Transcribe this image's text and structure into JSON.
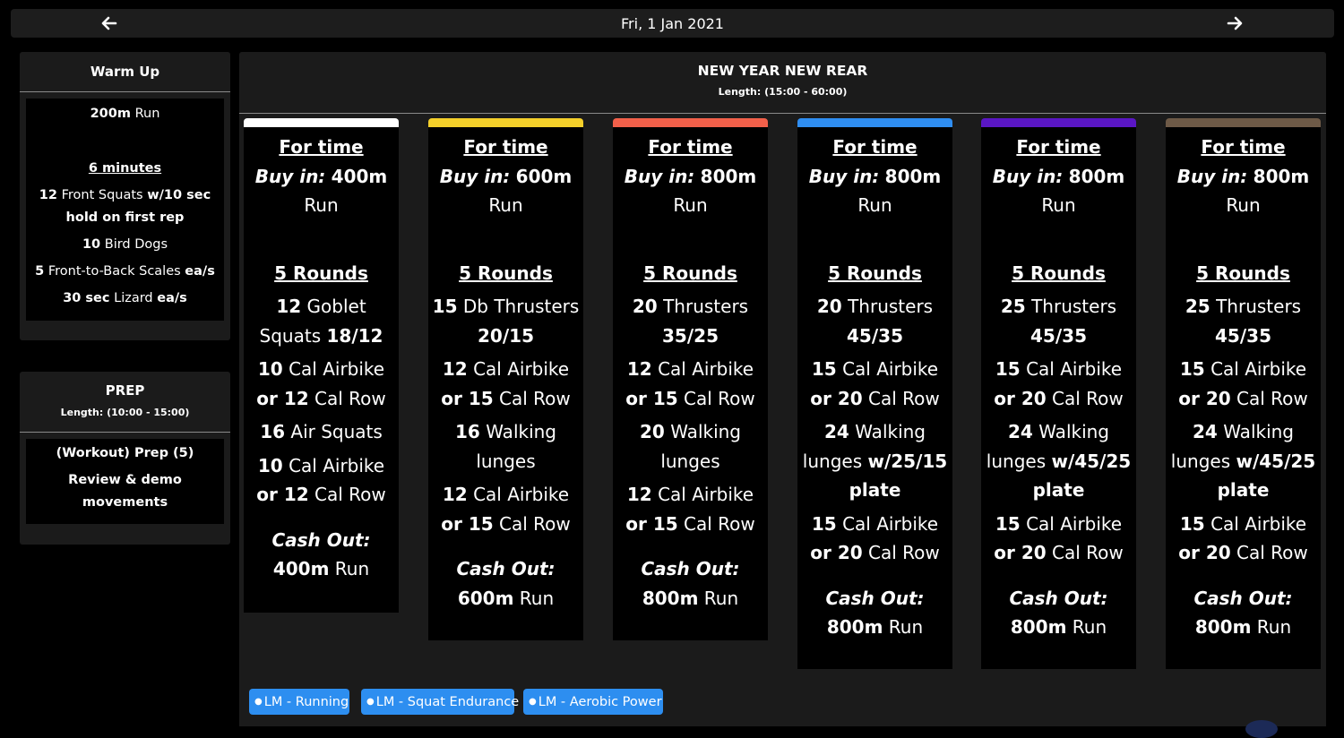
{
  "header": {
    "date": "Fri, 1 Jan 2021",
    "prev_icon": "arrow-left-icon",
    "next_icon": "arrow-right-icon"
  },
  "warmup": {
    "title": "Warm Up",
    "lines": [
      {
        "bold": "200m",
        "text": " Run"
      },
      {
        "underline": "6 minutes"
      },
      {
        "bold": "12",
        "text": " Front Squats ",
        "bold2": "w/10 sec hold on first rep"
      },
      {
        "bold": "10",
        "text": " Bird Dogs"
      },
      {
        "bold": "5",
        "text": " Front-to-Back Scales ",
        "bold2": "ea/s"
      },
      {
        "bold": "30 sec",
        "text": " Lizard ",
        "bold2": "ea/s"
      }
    ]
  },
  "prep": {
    "title": "PREP",
    "length": "Length: (10:00 - 15:00)",
    "line1": "(Workout) Prep (5)",
    "line2": "Review & demo movements"
  },
  "workout": {
    "title": "NEW YEAR NEW REAR",
    "length": "Length: (15:00 - 60:00)",
    "columns": [
      {
        "color": "#ffffff",
        "heading": "For time",
        "buyin_label": "Buy in:",
        "buyin_value": "400m",
        "buyin_text": "Run",
        "rounds": "5 Rounds",
        "m1_num": "12",
        "m1_text": "Goblet Squats",
        "m1_bold": "18/12",
        "m2_num": "10",
        "m2_text": "Cal Airbike",
        "m2_or": "or 12",
        "m2_tail": "Cal Row",
        "m3_num": "16",
        "m3_text": "Air Squats",
        "m3_bold": "",
        "m4_num": "10",
        "m4_text": "Cal Airbike",
        "m4_or": "or 12",
        "m4_tail": "Cal Row",
        "cashout_label": "Cash Out:",
        "cashout_value": "400m",
        "cashout_text": "Run"
      },
      {
        "color": "#f5d02a",
        "heading": "For time",
        "buyin_label": "Buy in:",
        "buyin_value": "600m",
        "buyin_text": "Run",
        "rounds": "5 Rounds",
        "m1_num": "15",
        "m1_text": "Db Thrusters",
        "m1_bold": "20/15",
        "m2_num": "12",
        "m2_text": "Cal Airbike",
        "m2_or": "or 15",
        "m2_tail": "Cal Row",
        "m3_num": "16",
        "m3_text": "Walking lunges",
        "m3_bold": "",
        "m4_num": "12",
        "m4_text": "Cal Airbike",
        "m4_or": "or 15",
        "m4_tail": "Cal Row",
        "cashout_label": "Cash Out:",
        "cashout_value": "600m",
        "cashout_text": "Run"
      },
      {
        "color": "#f2604a",
        "heading": "For time",
        "buyin_label": "Buy in:",
        "buyin_value": "800m",
        "buyin_text": "Run",
        "rounds": "5 Rounds",
        "m1_num": "20",
        "m1_text": "Thrusters",
        "m1_bold": "35/25",
        "m2_num": "12",
        "m2_text": "Cal Airbike",
        "m2_or": "or 15",
        "m2_tail": "Cal Row",
        "m3_num": "20",
        "m3_text": "Walking lunges",
        "m3_bold": "",
        "m4_num": "12",
        "m4_text": "Cal Airbike",
        "m4_or": "or 15",
        "m4_tail": "Cal Row",
        "cashout_label": "Cash Out:",
        "cashout_value": "800m",
        "cashout_text": "Run"
      },
      {
        "color": "#2f8ef2",
        "heading": "For time",
        "buyin_label": "Buy in:",
        "buyin_value": "800m",
        "buyin_text": "Run",
        "rounds": "5 Rounds",
        "m1_num": "20",
        "m1_text": "Thrusters",
        "m1_bold": "45/35",
        "m2_num": "15",
        "m2_text": "Cal Airbike",
        "m2_or": "or 20",
        "m2_tail": "Cal Row",
        "m3_num": "24",
        "m3_text": "Walking lunges",
        "m3_bold": "w/25/15 plate",
        "m4_num": "15",
        "m4_text": "Cal Airbike",
        "m4_or": "or 20",
        "m4_tail": "Cal Row",
        "cashout_label": "Cash Out:",
        "cashout_value": "800m",
        "cashout_text": "Run"
      },
      {
        "color": "#5a16c4",
        "heading": "For time",
        "buyin_label": "Buy in:",
        "buyin_value": "800m",
        "buyin_text": "Run",
        "rounds": "5 Rounds",
        "m1_num": "25",
        "m1_text": "Thrusters",
        "m1_bold": "45/35",
        "m2_num": "15",
        "m2_text": "Cal Airbike",
        "m2_or": "or 20",
        "m2_tail": "Cal Row",
        "m3_num": "24",
        "m3_text": "Walking lunges",
        "m3_bold": "w/45/25 plate",
        "m4_num": "15",
        "m4_text": "Cal Airbike",
        "m4_or": "or 20",
        "m4_tail": "Cal Row",
        "cashout_label": "Cash Out:",
        "cashout_value": "800m",
        "cashout_text": "Run"
      },
      {
        "color": "#6e5a47",
        "heading": "For time",
        "buyin_label": "Buy in:",
        "buyin_value": "800m",
        "buyin_text": "Run",
        "rounds": "5 Rounds",
        "m1_num": "25",
        "m1_text": "Thrusters",
        "m1_bold": "45/35",
        "m2_num": "15",
        "m2_text": "Cal Airbike",
        "m2_or": "or 20",
        "m2_tail": "Cal Row",
        "m3_num": "24",
        "m3_text": "Walking lunges",
        "m3_bold": "w/45/25 plate",
        "m4_num": "15",
        "m4_text": "Cal Airbike",
        "m4_or": "or 20",
        "m4_tail": "Cal Row",
        "cashout_label": "Cash Out:",
        "cashout_value": "800m",
        "cashout_text": "Run"
      }
    ]
  },
  "tags": [
    {
      "label": "LM - Running"
    },
    {
      "label": "LM - Squat Endurance"
    },
    {
      "label": "LM - Aerobic Power"
    }
  ],
  "colors": {
    "tag": "#2d8ef0",
    "panel": "#1b1b1b"
  }
}
